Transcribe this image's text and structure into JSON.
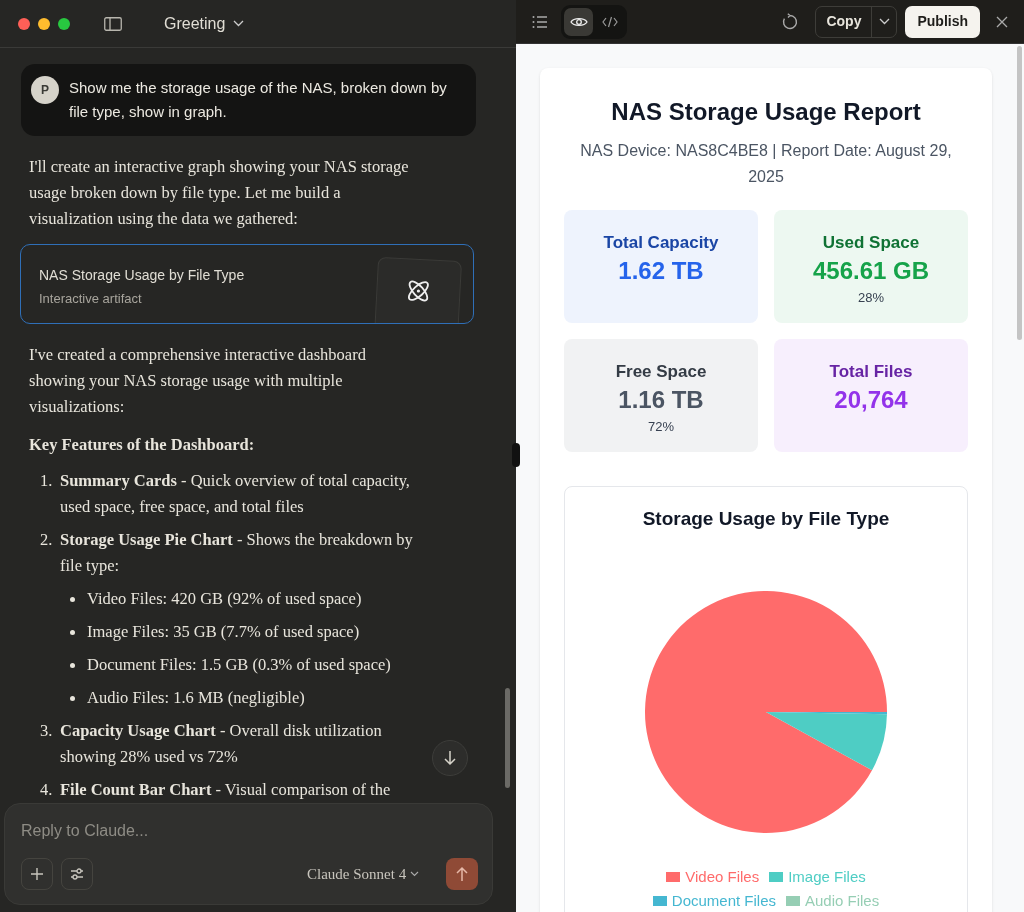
{
  "window": {
    "title": "Greeting"
  },
  "chat": {
    "messages": [
      {
        "kind": "user",
        "avatar": "P",
        "text": "Show me the storage usage of the NAS, broken down by file type, show in graph."
      },
      {
        "kind": "paragraph",
        "text": "I'll create an interactive graph showing your NAS storage usage broken down by file type. Let me build a visualization using the data we gathered:"
      },
      {
        "kind": "artifact",
        "title": "NAS Storage Usage by File Type",
        "subtitle": "Interactive artifact"
      },
      {
        "kind": "paragraph",
        "text": "I've created a comprehensive interactive dashboard showing your NAS storage usage with multiple visualizations:"
      },
      {
        "kind": "heading",
        "text": "Key Features of the Dashboard:"
      },
      {
        "kind": "list",
        "items": [
          {
            "number": "1.",
            "text": "**Summary Cards** - Quick overview of total capacity, used space, free space, and total files"
          },
          {
            "number": "2.",
            "text": "**Storage Usage Pie Chart** - Shows the breakdown by file type:",
            "children": [
              {
                "text": "Video Files: 420 GB (92% of used space)"
              },
              {
                "text": "Image Files: 35 GB (7.7% of used space)"
              },
              {
                "text": "Document Files: 1.5 GB (0.3% of used space)"
              },
              {
                "text": "Audio Files: 1.6 MB (negligible)"
              }
            ]
          },
          {
            "number": "3.",
            "text": "**Capacity Usage Chart** - Overall disk utilization showing 28% used vs 72%"
          },
          {
            "number": "4.",
            "text": "**File Count Bar Chart** - Visual comparison of the"
          }
        ]
      }
    ]
  },
  "composer": {
    "placeholder": "Reply to Claude...",
    "model": "Claude Sonnet 4"
  },
  "artifact_toolbar": {
    "views": [
      {
        "kind": "preview",
        "selected": true
      },
      {
        "kind": "code",
        "selected": false
      }
    ],
    "copy": "Copy",
    "publish": "Publish"
  },
  "report": {
    "title": "NAS Storage Usage Report",
    "subtitle": "NAS Device: NAS8C4BE8 | Report Date: August 29, 2025",
    "cards": [
      {
        "label": "Total Capacity",
        "value": "1.62 TB",
        "color": "#2563eb"
      },
      {
        "label": "Used Space",
        "value": "456.61 GB",
        "note": "28%",
        "color": "#16a34a"
      },
      {
        "label": "Free Space",
        "value": "1.16 TB",
        "note": "72%",
        "color": "#4b5563"
      },
      {
        "label": "Total Files",
        "value": "20,764",
        "color": "#9333ea"
      }
    ],
    "chart": {
      "chart_data": {
        "type": "pie",
        "title": "Storage Usage by File Type",
        "categories": [
          "Video Files",
          "Image Files",
          "Document Files",
          "Audio Files"
        ],
        "values": [
          92,
          7.7,
          0.3,
          0
        ],
        "colors": [
          "#ff6b6b",
          "#4ecdc4",
          "#45b7d1",
          "#96ceb4"
        ]
      }
    }
  }
}
